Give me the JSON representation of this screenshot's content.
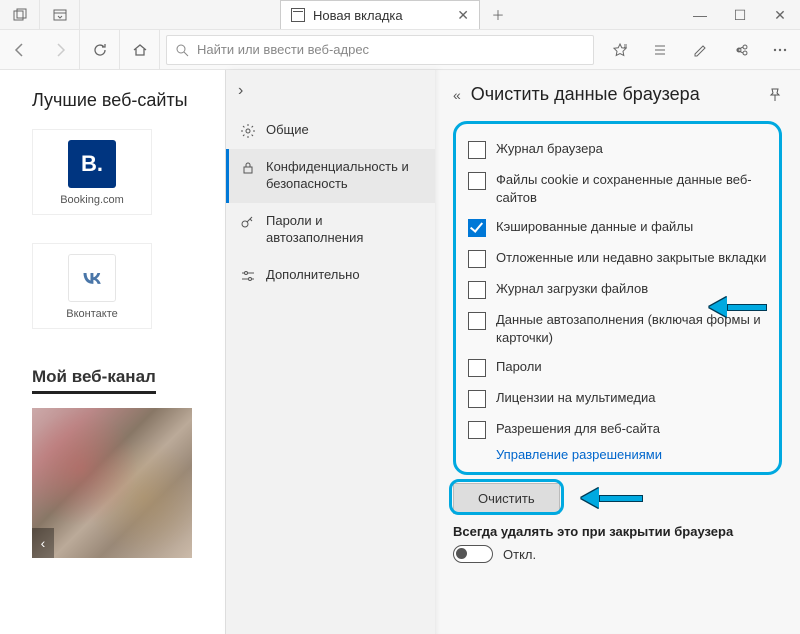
{
  "tab": {
    "title": "Новая вкладка"
  },
  "toolbar": {
    "search_placeholder": "Найти или ввести веб-адрес"
  },
  "topsites": {
    "heading": "Лучшие веб-сайты",
    "tiles": [
      {
        "logo_text": "B.",
        "label": "Booking.com"
      },
      {
        "logo_text": "",
        "label": "Вконтакте"
      }
    ]
  },
  "feed": {
    "heading": "Мой веб-канал"
  },
  "settings": {
    "items": [
      {
        "label": "Общие"
      },
      {
        "label": "Конфиденциальность и безопасность"
      },
      {
        "label": "Пароли и автозаполнения"
      },
      {
        "label": "Дополнительно"
      }
    ]
  },
  "clear_panel": {
    "title": "Очистить данные браузера",
    "options": [
      {
        "label": "Журнал браузера",
        "checked": false
      },
      {
        "label": "Файлы cookie и сохраненные данные веб-сайтов",
        "checked": false
      },
      {
        "label": "Кэшированные данные и файлы",
        "checked": true
      },
      {
        "label": "Отложенные или недавно закрытые вкладки",
        "checked": false
      },
      {
        "label": "Журнал загрузки файлов",
        "checked": false
      },
      {
        "label": "Данные автозаполнения (включая формы и карточки)",
        "checked": false
      },
      {
        "label": "Пароли",
        "checked": false
      },
      {
        "label": "Лицензии на мультимедиа",
        "checked": false
      },
      {
        "label": "Разрешения для веб-сайта",
        "checked": false
      }
    ],
    "manage_link": "Управление разрешениями",
    "clear_button": "Очистить",
    "always_label": "Всегда удалять это при закрытии браузера",
    "toggle_label": "Откл."
  }
}
